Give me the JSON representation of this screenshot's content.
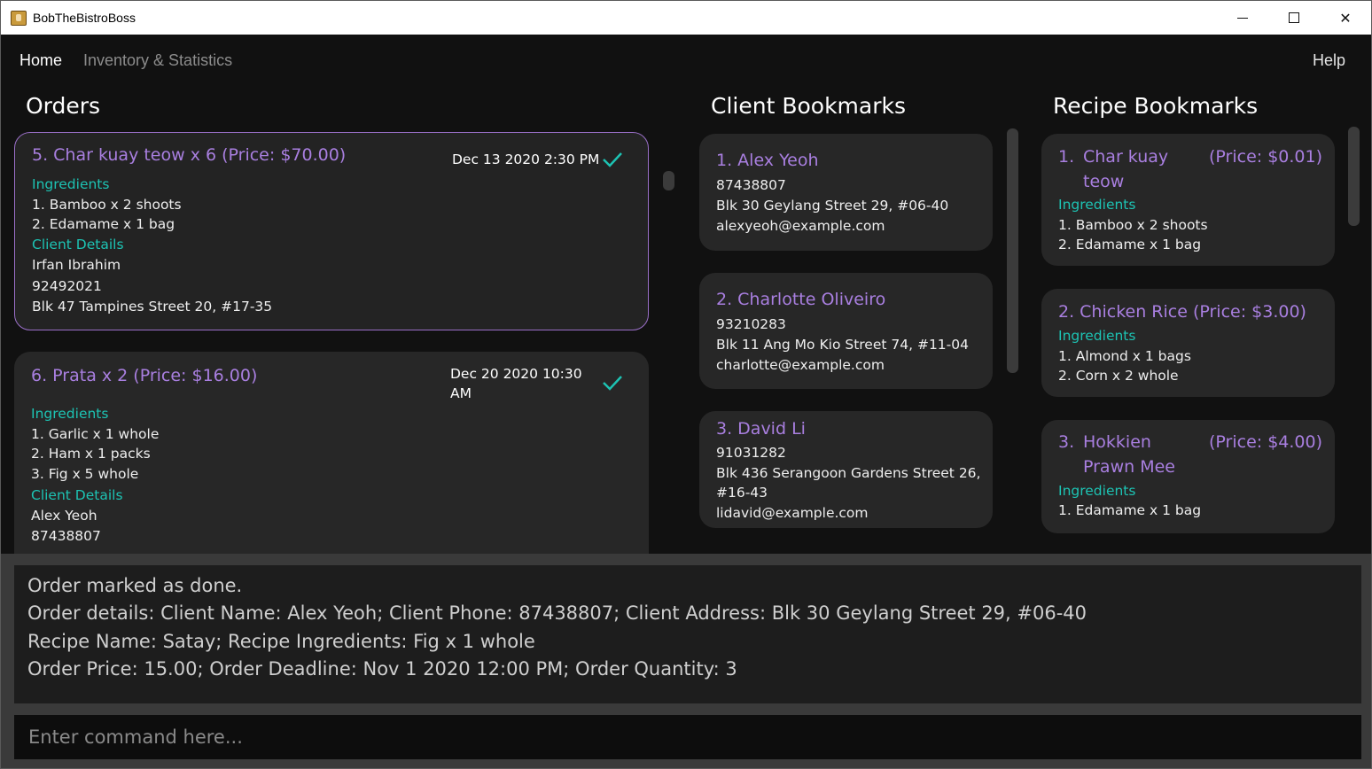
{
  "window": {
    "title": "BobTheBistroBoss",
    "minimize": "",
    "maximize": "",
    "close": "✕"
  },
  "menu": {
    "home": "Home",
    "inventory": "Inventory & Statistics",
    "help": "Help"
  },
  "orders": {
    "title": "Orders",
    "items": [
      {
        "heading": "5.  Char kuay teow x 6 (Price: $70.00)",
        "deadline": "Dec 13 2020 2:30 PM",
        "done": true,
        "ingredients_label": "Ingredients",
        "ingredients": [
          "1. Bamboo x 2 shoots",
          "2. Edamame x 1 bag"
        ],
        "client_label": "Client Details",
        "client": [
          "Irfan Ibrahim",
          "92492021",
          "Blk 47 Tampines Street 20, #17-35"
        ]
      },
      {
        "heading": "6.  Prata x 2 (Price: $16.00)",
        "deadline_line1": "Dec 20 2020 10:30",
        "deadline_line2": "AM",
        "done": true,
        "ingredients_label": "Ingredients",
        "ingredients": [
          "1. Garlic x 1 whole",
          "2. Ham x 1 packs",
          "3. Fig x 5 whole"
        ],
        "client_label": "Client Details",
        "client": [
          "Alex Yeoh",
          "87438807"
        ]
      }
    ]
  },
  "clients": {
    "title": "Client Bookmarks",
    "items": [
      {
        "heading": "1.  Alex Yeoh",
        "phone": "87438807",
        "address": "Blk 30 Geylang Street 29, #06-40",
        "email": "alexyeoh@example.com"
      },
      {
        "heading": "2.  Charlotte Oliveiro",
        "phone": "93210283",
        "address": "Blk 11 Ang Mo Kio Street 74, #11-04",
        "email": "charlotte@example.com"
      },
      {
        "heading": "3.  David Li",
        "phone": "91031282",
        "address_line1": "Blk 436 Serangoon Gardens Street 26,",
        "address_line2": "#16-43",
        "email": "lidavid@example.com"
      }
    ]
  },
  "recipes": {
    "title": "Recipe Bookmarks",
    "items": [
      {
        "index": "1.",
        "name_line1": "Char kuay",
        "name_line2": "teow",
        "price": "(Price: $0.01)",
        "ingredients_label": "Ingredients",
        "ingredients": [
          "1. Bamboo x 2 shoots",
          "2. Edamame x 1 bag"
        ]
      },
      {
        "heading": "2.  Chicken Rice (Price: $3.00)",
        "ingredients_label": "Ingredients",
        "ingredients": [
          "1. Almond x 1 bags",
          "2. Corn x 2 whole"
        ]
      },
      {
        "index": "3.",
        "name_line1": "Hokkien",
        "name_line2": "Prawn Mee",
        "price": "(Price: $4.00)",
        "ingredients_label": "Ingredients",
        "ingredients": [
          "1. Edamame x 1 bag"
        ]
      }
    ]
  },
  "result": {
    "lines": [
      "Order marked as done.",
      "Order details: Client Name: Alex Yeoh; Client Phone: 87438807; Client Address: Blk 30 Geylang Street 29, #06-40",
      "Recipe Name: Satay; Recipe Ingredients: Fig x 1 whole",
      "Order Price: 15.00; Order Deadline: Nov 1 2020 12:00 PM; Order Quantity: 3"
    ]
  },
  "command": {
    "value": "",
    "placeholder": "Enter command here..."
  },
  "colors": {
    "accent_purple": "#a97fe0",
    "label_teal": "#1dc3b3",
    "background": "#111111",
    "card": "#272727"
  }
}
